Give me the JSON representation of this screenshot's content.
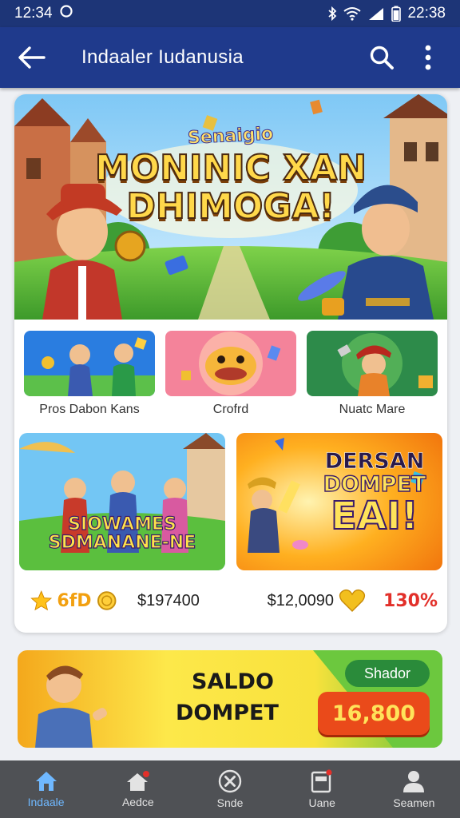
{
  "status_bar": {
    "time_left": "12:34",
    "time_right": "22:38"
  },
  "app_bar": {
    "title": "Indaaler Iudanusia"
  },
  "hero": {
    "subtitle": "Senaigio",
    "title_line1": "MONINIC XAN",
    "title_line2": "DHIMOGA!"
  },
  "tiles": [
    {
      "label": "Pros Dabon Kans"
    },
    {
      "label": "Crofrd"
    },
    {
      "label": "Nuatc Mare"
    }
  ],
  "big_cards": [
    {
      "text_line1": "SIOWAMES",
      "text_line2": "SDMANANE-NE"
    },
    {
      "text_line1": "DERSAN",
      "text_line2": "DOMPET",
      "text_line3": "EAI!"
    }
  ],
  "stats": {
    "stars": "6fD",
    "value1": "$197400",
    "value2": "$12,0090",
    "percent": "130%"
  },
  "saldo": {
    "line1": "SALDO",
    "line2": "DOMPET",
    "pill": "Shador",
    "amount": "16,800"
  },
  "bottom_nav": [
    {
      "label": "Indaale",
      "active": true
    },
    {
      "label": "Aedce",
      "active": false
    },
    {
      "label": "Snde",
      "active": false
    },
    {
      "label": "Uane",
      "active": false
    },
    {
      "label": "Seamen",
      "active": false
    }
  ],
  "colors": {
    "app_bar": "#1f3a8c",
    "status_bar": "#1d3577",
    "nav_active": "#6fb8ff",
    "nav_bg": "#4f5155",
    "percent": "#e2302a"
  }
}
